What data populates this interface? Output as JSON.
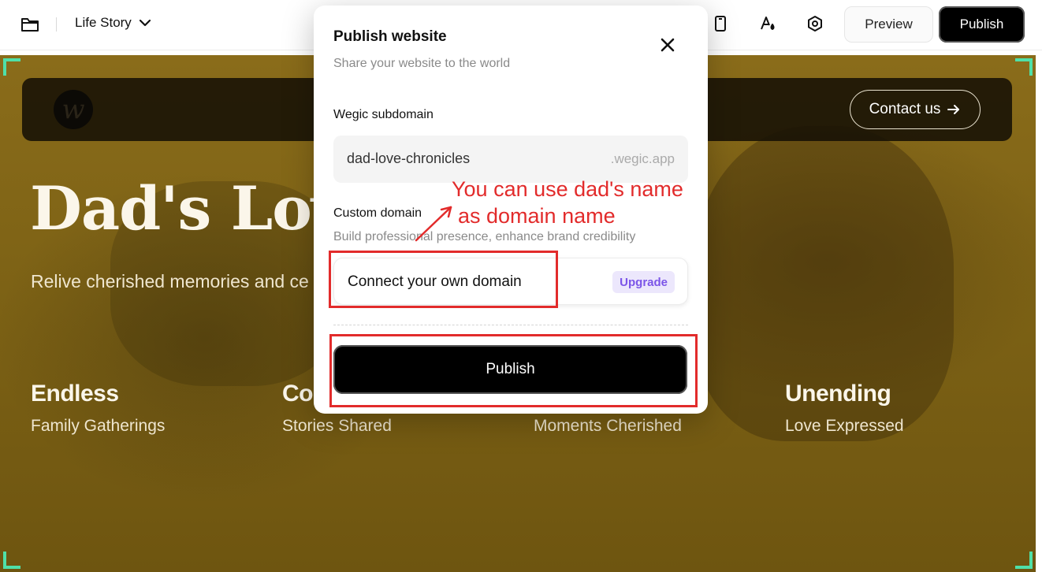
{
  "topbar": {
    "project_name": "Life Story",
    "preview_label": "Preview",
    "publish_label": "Publish",
    "icons": [
      "folder-icon",
      "chevron-down-icon",
      "mobile-device-icon",
      "font-style-icon",
      "settings-icon"
    ]
  },
  "site": {
    "contact_label": "Contact us",
    "hero_title": "Dad's Love",
    "hero_subtitle": "Relive cherished memories and ce",
    "stats": [
      {
        "big": "Endless",
        "small": "Family Gatherings"
      },
      {
        "big": "Cou",
        "small": "Stories Shared"
      },
      {
        "big": "",
        "small": "Moments Cherished"
      },
      {
        "big": "Unending",
        "small": "Love Expressed"
      }
    ]
  },
  "modal": {
    "title": "Publish website",
    "subtitle": "Share your website to the world",
    "subdomain_label": "Wegic subdomain",
    "subdomain_value": "dad-love-chronicles",
    "subdomain_suffix": ".wegic.app",
    "custom_domain_label": "Custom domain",
    "custom_domain_desc": "Build professional presence, enhance brand credibility",
    "connect_label": "Connect your own domain",
    "upgrade_label": "Upgrade",
    "publish_label": "Publish"
  },
  "annotation": {
    "line1": "You can use dad's name",
    "line2": "as domain name",
    "color": "#e22b2b"
  },
  "colors": {
    "accent_purple": "#7b55e8",
    "selection_corner": "#4fe0a8",
    "overlay_gold": "#7d6215"
  }
}
